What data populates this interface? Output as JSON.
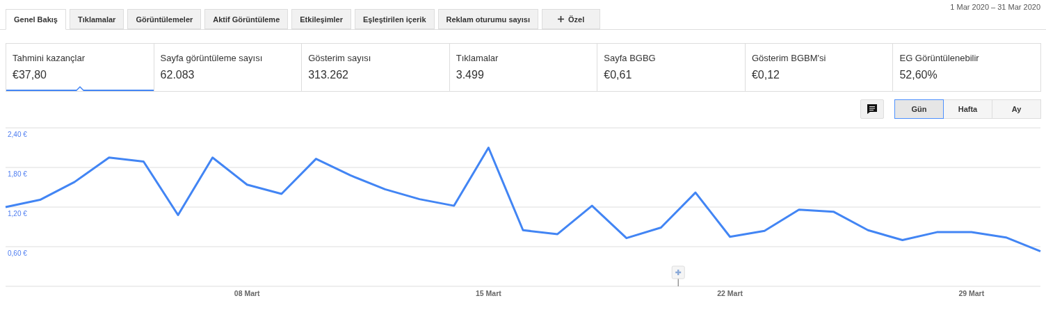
{
  "tabs": [
    {
      "label": "Genel Bakış",
      "selected": true
    },
    {
      "label": "Tıklamalar",
      "selected": false
    },
    {
      "label": "Görüntülemeler",
      "selected": false
    },
    {
      "label": "Aktif Görüntüleme",
      "selected": false
    },
    {
      "label": "Etkileşimler",
      "selected": false
    },
    {
      "label": "Eşleştirilen içerik",
      "selected": false
    },
    {
      "label": "Reklam oturumu sayısı",
      "selected": false
    },
    {
      "label": "Özel",
      "selected": false,
      "kind": "add"
    }
  ],
  "date_range": "1 Mar 2020 – 31 Mar 2020",
  "metrics": [
    {
      "label": "Tahmini kazançlar",
      "value": "€37,80",
      "selected": true
    },
    {
      "label": "Sayfa görüntüleme sayısı",
      "value": "62.083",
      "selected": false
    },
    {
      "label": "Gösterim sayısı",
      "value": "313.262",
      "selected": false
    },
    {
      "label": "Tıklamalar",
      "value": "3.499",
      "selected": false
    },
    {
      "label": "Sayfa BGBG",
      "value": "€0,61",
      "selected": false
    },
    {
      "label": "Gösterim BGBM'si",
      "value": "€0,12",
      "selected": false
    },
    {
      "label": "EG Görüntülenebilir",
      "value": "52,60%",
      "selected": false
    }
  ],
  "period_buttons": [
    {
      "label": "Gün",
      "selected": true
    },
    {
      "label": "Hafta",
      "selected": false
    },
    {
      "label": "Ay",
      "selected": false
    }
  ],
  "chart": {
    "chart_data": {
      "type": "line",
      "categories": [
        null,
        null,
        null,
        null,
        null,
        null,
        null,
        "08 Mart",
        null,
        null,
        null,
        null,
        null,
        null,
        "15 Mart",
        null,
        null,
        null,
        null,
        null,
        null,
        "22 Mart",
        null,
        null,
        null,
        null,
        null,
        null,
        "29 Mart",
        null,
        null
      ],
      "series": [
        {
          "color": "#4285f4",
          "values": [
            1.2,
            1.31,
            1.58,
            1.95,
            1.89,
            1.08,
            1.95,
            1.54,
            1.4,
            1.93,
            1.68,
            1.47,
            1.32,
            1.22,
            2.1,
            0.85,
            0.79,
            1.22,
            0.73,
            0.89,
            1.42,
            0.75,
            0.84,
            1.16,
            1.13,
            0.85,
            0.7,
            0.82,
            0.82,
            0.74,
            0.53
          ]
        }
      ],
      "ylim": [
        0,
        2.4
      ],
      "grid": true,
      "yticks": [
        {
          "value": 0.6,
          "label": "0,60 €"
        },
        {
          "value": 1.2,
          "label": "1,20 €"
        },
        {
          "value": 1.8,
          "label": "1,80 €"
        },
        {
          "value": 2.4,
          "label": "2,40 €"
        }
      ]
    },
    "annotation_marker": {
      "kind": "add"
    }
  }
}
